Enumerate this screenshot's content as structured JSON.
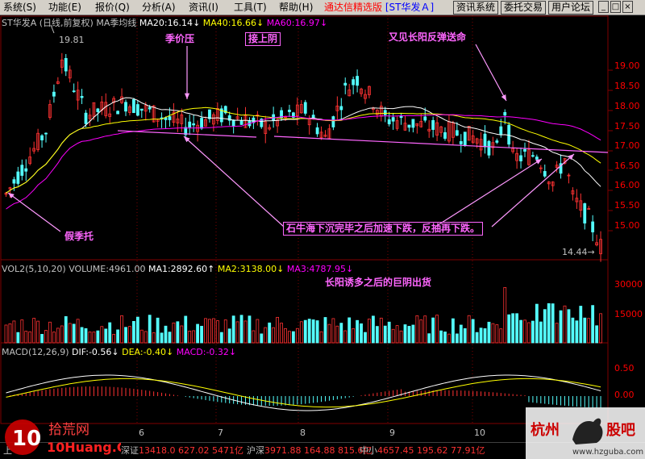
{
  "menu": {
    "items": [
      "系统(S)",
      "功能(E)",
      "报价(Q)",
      "分析(A)",
      "资讯(I)",
      "工具(T)",
      "帮助(H)"
    ],
    "app_title": "通达信精选版",
    "stock_tag": "[ST华发Ａ]",
    "buttons": [
      "资讯系统",
      "委托交易",
      "用户论坛"
    ]
  },
  "price_info": {
    "name": "ST华发A",
    "period": "(日线,前复权)",
    "indicator": "MA季均线",
    "ma20": "MA20:16.14",
    "ma40": "MA40:16.66",
    "ma60": "MA60:16.97",
    "high_label": "19.81",
    "low_label": "14.44"
  },
  "volume_info": {
    "label": "VOL2(5,10,20)",
    "volume": "VOLUME:4961.00",
    "ma1": "MA1:2892.60",
    "ma2": "MA2:3138.00",
    "ma3": "MA3:4787.95"
  },
  "macd_info": {
    "label": "MACD(12,26,9)",
    "dif": "DIF:-0.56",
    "dea": "DEA:-0.40",
    "macd": "MACD:-0.32"
  },
  "annotations": {
    "jijiya": "季价压",
    "tiezhuangyong": "接上阴",
    "yangfan": "又见长阳反弹送命",
    "jiaji": "假季托",
    "shiniu": "石牛海下沉完毕之后加速下跌，反抽再下跌。",
    "changyang": "长阳诱多之后的巨阴出货"
  },
  "price_axis": [
    "19.00",
    "18.50",
    "18.00",
    "17.50",
    "17.00",
    "16.50",
    "16.00",
    "15.50",
    "15.00"
  ],
  "vol_axis": [
    "30000",
    "15000"
  ],
  "macd_axis": [
    "0.50",
    "0.00"
  ],
  "date_axis": [
    "6",
    "7",
    "8",
    "9",
    "10"
  ],
  "status": {
    "sh_label": "上",
    "sz_label": "深证",
    "sz_vals": "13418.0 627.02 5471亿",
    "hs_label": "沪深",
    "hs_vals": "3971.88 164.88 815.6亿",
    "zx_label": "中小",
    "zx_vals": "4657.45 195.62 77.91亿"
  },
  "watermark_left": {
    "brand": "拾荒网",
    "url": "10Huang.CN"
  },
  "watermark_right": {
    "brand": "杭州",
    "brand2": "股吧",
    "url": "www.hzguba.com"
  },
  "colors": {
    "up": "#ff3232",
    "down": "#54ffff",
    "ma20": "#ffffff",
    "ma40": "#ffff00",
    "ma60": "#ff00ff",
    "grid": "#800000"
  }
}
